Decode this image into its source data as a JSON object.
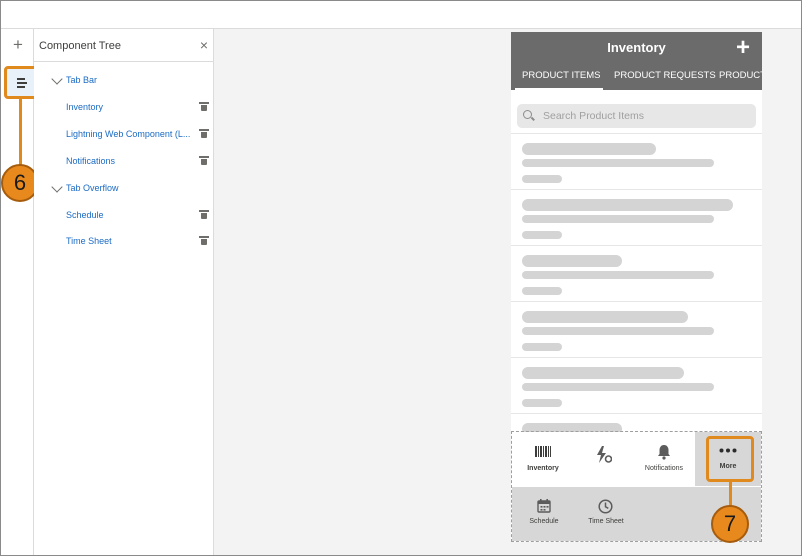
{
  "annotations": {
    "step6": "6",
    "step7": "7"
  },
  "rail": {
    "add_symbol": "+"
  },
  "panel": {
    "title": "Component Tree",
    "close_symbol": "×",
    "tree": [
      {
        "label": "Tab Bar",
        "type": "group"
      },
      {
        "label": "Inventory",
        "type": "item"
      },
      {
        "label": "Lightning Web Component (L...",
        "type": "item"
      },
      {
        "label": "Notifications",
        "type": "item"
      },
      {
        "label": "Tab Overflow",
        "type": "group"
      },
      {
        "label": "Schedule",
        "type": "item"
      },
      {
        "label": "Time Sheet",
        "type": "item"
      }
    ]
  },
  "preview": {
    "title": "Inventory",
    "add_symbol": "+",
    "tabs": [
      "PRODUCT ITEMS",
      "PRODUCT REQUESTS",
      "PRODUCT"
    ],
    "search_placeholder": "Search Product Items",
    "tabbar": [
      {
        "label": "Inventory",
        "icon": "barcode-icon"
      },
      {
        "label": "",
        "icon": "lightning-gear-icon"
      },
      {
        "label": "Notifications",
        "icon": "bell-icon"
      },
      {
        "label": "More",
        "icon": "ellipsis-icon"
      }
    ],
    "overflow": [
      {
        "label": "Schedule",
        "icon": "calendar-icon"
      },
      {
        "label": "Time Sheet",
        "icon": "clock-icon"
      }
    ]
  },
  "colors": {
    "accent_orange": "#e8891d",
    "header_gray": "#6b6b6b",
    "link_blue": "#1b6bc3"
  }
}
